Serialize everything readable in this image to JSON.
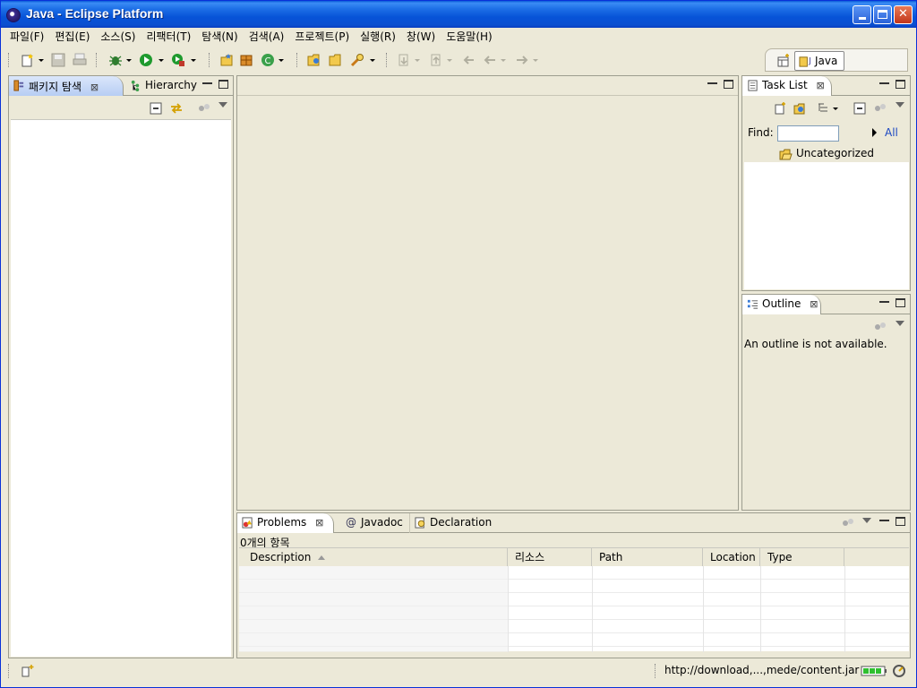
{
  "window": {
    "title": "Java - Eclipse Platform",
    "controls": [
      "minimize",
      "maximize",
      "close"
    ]
  },
  "menubar": {
    "items": [
      {
        "label": "파일(F)"
      },
      {
        "label": "편집(E)"
      },
      {
        "label": "소스(S)"
      },
      {
        "label": "리팩터(T)"
      },
      {
        "label": "탐색(N)"
      },
      {
        "label": "검색(A)"
      },
      {
        "label": "프로젝트(P)"
      },
      {
        "label": "실행(R)"
      },
      {
        "label": "창(W)"
      },
      {
        "label": "도움말(H)"
      }
    ]
  },
  "perspective": {
    "label": "Java"
  },
  "left_panel": {
    "tabs": [
      {
        "label": "패키지 탐색",
        "icon": "package-explorer-icon"
      },
      {
        "label": "Hierarchy",
        "icon": "hierarchy-icon"
      }
    ]
  },
  "task_list": {
    "tab_label": "Task List",
    "find_label": "Find:",
    "find_value": "",
    "all_link": "All",
    "category": "Uncategorized"
  },
  "outline": {
    "tab_label": "Outline",
    "message": "An outline is not available."
  },
  "bottom_panel": {
    "tabs": [
      {
        "label": "Problems",
        "icon": "problems-icon"
      },
      {
        "label": "Javadoc",
        "icon": "at-icon"
      },
      {
        "label": "Declaration",
        "icon": "declaration-icon"
      }
    ],
    "item_count": "0개의 항목",
    "columns": [
      "Description",
      "리소스",
      "Path",
      "Location",
      "Type"
    ]
  },
  "statusbar": {
    "message": "http://download,...,mede/content.jar"
  },
  "colors": {
    "window_bg": "#ece9d8",
    "titlebar": "#0a56d8",
    "panel_border": "#9d9d8f"
  }
}
